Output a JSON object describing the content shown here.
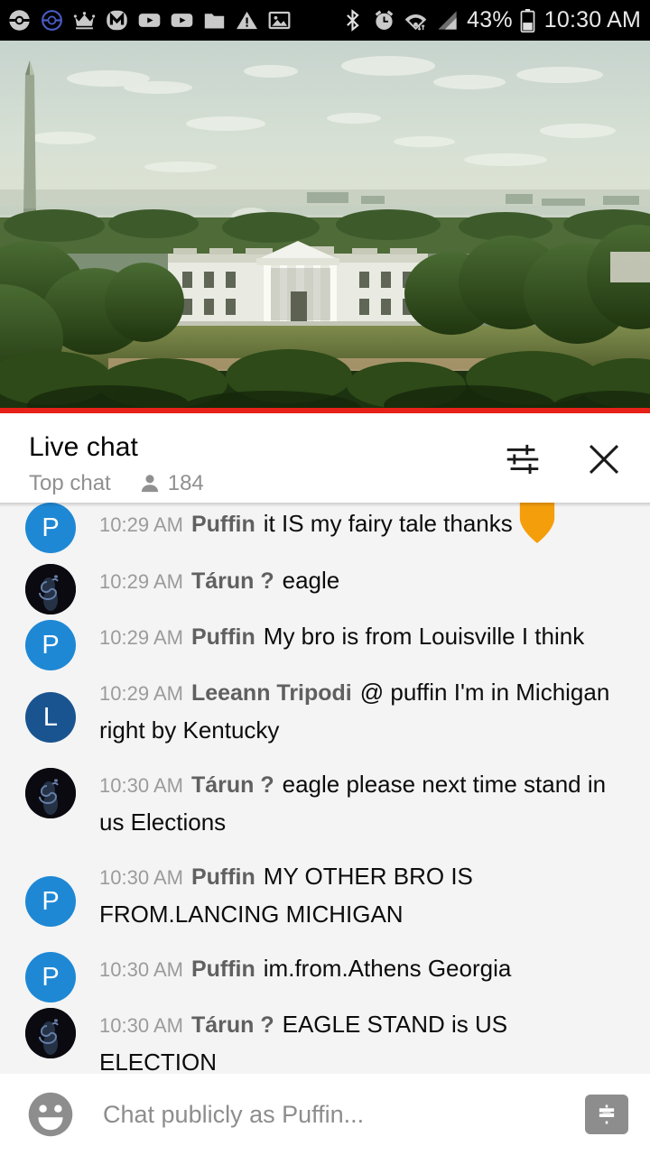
{
  "statusbar": {
    "left_icons": [
      {
        "name": "pokeball-grey-icon"
      },
      {
        "name": "pokeball-blue-icon"
      },
      {
        "name": "crown-icon"
      },
      {
        "name": "messenger-m-icon"
      },
      {
        "name": "youtube-play-icon"
      },
      {
        "name": "youtube-play-icon-2"
      },
      {
        "name": "folder-icon"
      },
      {
        "name": "warning-triangle-icon"
      },
      {
        "name": "image-icon"
      }
    ],
    "right_icons": [
      {
        "name": "bluetooth-icon"
      },
      {
        "name": "alarm-clock-icon"
      },
      {
        "name": "wifi-icon"
      },
      {
        "name": "cellular-signal-icon"
      }
    ],
    "battery_percent": "43%",
    "clock": "10:30 AM"
  },
  "video": {
    "scene": "white-house-washington-monument-live-stream",
    "progress_color": "#e62117",
    "progress_percent": 100
  },
  "chat_header": {
    "title": "Live chat",
    "subtitle": "Top chat",
    "viewer_count": "184",
    "settings_label": "chat-settings",
    "close_label": "close-live-chat"
  },
  "messages": [
    {
      "time": "10:29 AM",
      "author": "Puffin",
      "text": "it IS my fairy tale thanks",
      "avatar_letter": "P",
      "avatar_color": "#1e88d5",
      "avatar_type": "letter",
      "badge": "orange-heart",
      "badge_color": "#f9a825",
      "clipped": true
    },
    {
      "time": "10:29 AM",
      "author": "Tárun ?",
      "text": "eagle",
      "avatar_letter": "",
      "avatar_color": "#0b0b12",
      "avatar_type": "om"
    },
    {
      "time": "10:29 AM",
      "author": "Puffin",
      "text": "My bro is from Louisville I think",
      "avatar_letter": "P",
      "avatar_color": "#1e88d5",
      "avatar_type": "letter"
    },
    {
      "time": "10:29 AM",
      "author": "Leeann Tripodi",
      "text": "@ puffin I'm in Michigan right by Kentucky",
      "avatar_letter": "L",
      "avatar_color": "#1a5490",
      "avatar_type": "letter"
    },
    {
      "time": "10:30 AM",
      "author": "Tárun ?",
      "text": "eagle please next time stand in us Elections",
      "avatar_letter": "",
      "avatar_color": "#0b0b12",
      "avatar_type": "om"
    },
    {
      "time": "10:30 AM",
      "author": "Puffin",
      "text": "MY OTHER BRO IS FROM.LANCING MICHIGAN",
      "avatar_letter": "P",
      "avatar_color": "#1e88d5",
      "avatar_type": "letter"
    },
    {
      "time": "10:30 AM",
      "author": "Puffin",
      "text": "im.from.Athens Georgia",
      "avatar_letter": "P",
      "avatar_color": "#1e88d5",
      "avatar_type": "letter"
    },
    {
      "time": "10:30 AM",
      "author": "Tárun ?",
      "text": "EAGLE STAND is US ELECTION",
      "avatar_letter": "",
      "avatar_color": "#0b0b12",
      "avatar_type": "om"
    }
  ],
  "input_bar": {
    "placeholder": "Chat publicly as Puffin...",
    "value": "",
    "emoji_label": "emoji-picker",
    "superchat_label": "super-chat"
  }
}
